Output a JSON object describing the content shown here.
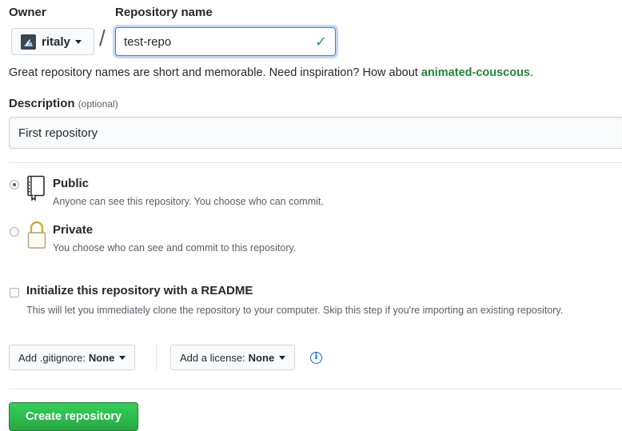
{
  "owner": {
    "label": "Owner",
    "selected": "ritaly"
  },
  "separator": "/",
  "repository_name": {
    "label": "Repository name",
    "value": "test-repo",
    "valid_icon": "check-icon"
  },
  "name_hint": {
    "text": "Great repository names are short and memorable. Need inspiration? How about ",
    "suggestion": "animated-couscous",
    "end": "."
  },
  "description": {
    "label": "Description",
    "optional": "(optional)",
    "value": "First repository"
  },
  "visibility": {
    "selected": "public",
    "public": {
      "title": "Public",
      "note": "Anyone can see this repository. You choose who can commit.",
      "icon": "repo-book-icon"
    },
    "private": {
      "title": "Private",
      "note": "You choose who can see and commit to this repository.",
      "icon": "lock-icon"
    }
  },
  "initialize": {
    "checked": false,
    "label": "Initialize this repository with a README",
    "note": "This will let you immediately clone the repository to your computer. Skip this step if you're importing an existing repository."
  },
  "gitignore": {
    "prefix": "Add .gitignore:",
    "value": "None"
  },
  "license": {
    "prefix": "Add a license:",
    "value": "None",
    "info_icon": "info-icon"
  },
  "submit": {
    "label": "Create repository"
  },
  "colors": {
    "accent_green": "#28a745",
    "suggestion_green": "#22863a",
    "focus_blue": "#2188ff",
    "text": "#24292e",
    "muted": "#586069"
  }
}
